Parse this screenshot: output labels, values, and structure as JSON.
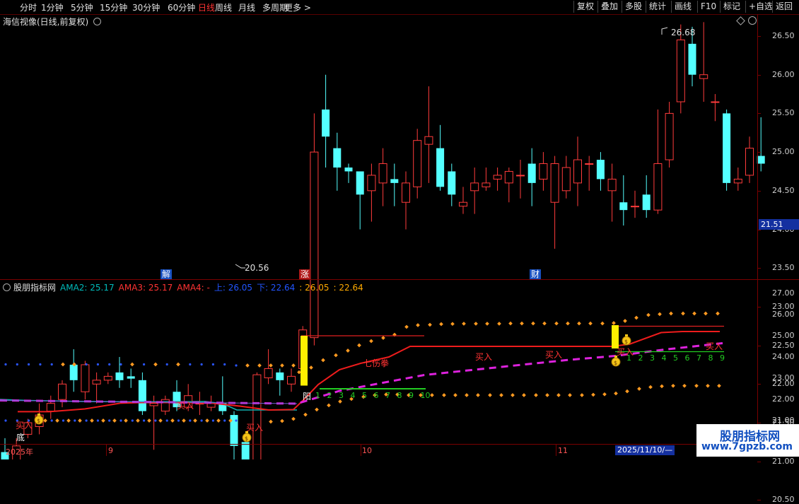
{
  "toolbar": {
    "periods": [
      "分时",
      "1分钟",
      "5分钟",
      "15分钟",
      "30分钟",
      "60分钟",
      "日线",
      "周线",
      "月线",
      "多周期",
      "更多 >"
    ],
    "active_period": "日线",
    "right_buttons": [
      "复权",
      "叠加",
      "多股",
      "统计",
      "画线",
      "F10",
      "标记",
      "+自选",
      "返回"
    ]
  },
  "main_chart": {
    "title": "海信视像(日线,前复权)",
    "price_axis": [
      "26.50",
      "26.00",
      "25.50",
      "25.00",
      "24.50",
      "24.00",
      "23.50",
      "23.00",
      "22.50",
      "22.00",
      "21.50",
      "21.00",
      "20.50"
    ],
    "current_price": "21.51",
    "high_label": "26.68",
    "low_label": "20.56",
    "event_markers": [
      {
        "text": "解",
        "color": "#2b6cff"
      },
      {
        "text": "涨",
        "color": "#d02020"
      },
      {
        "text": "财",
        "color": "#2b6cff"
      }
    ],
    "colors": {
      "up": "#ff3b3b",
      "down": "#54ffff"
    },
    "candles": [
      [
        21.12,
        21.0,
        20.9,
        21.3
      ],
      [
        21.0,
        21.2,
        20.85,
        21.3
      ],
      [
        21.35,
        21.5,
        21.3,
        21.55
      ],
      [
        21.45,
        21.6,
        21.35,
        21.75
      ],
      [
        21.65,
        21.75,
        21.55,
        21.85
      ],
      [
        21.8,
        22.0,
        21.7,
        22.05
      ],
      [
        22.25,
        22.05,
        21.9,
        22.45
      ],
      [
        21.9,
        22.25,
        21.8,
        22.3
      ],
      [
        22.0,
        22.05,
        21.75,
        22.15
      ],
      [
        22.05,
        22.1,
        22.0,
        22.15
      ],
      [
        22.15,
        22.05,
        21.95,
        22.35
      ],
      [
        22.1,
        22.07,
        21.95,
        22.2
      ],
      [
        22.05,
        21.65,
        21.6,
        22.15
      ],
      [
        21.72,
        21.75,
        21.15,
        21.85
      ],
      [
        21.65,
        21.8,
        21.6,
        21.85
      ],
      [
        21.9,
        21.7,
        21.65,
        22.05
      ],
      [
        21.7,
        21.85,
        21.65,
        22.0
      ],
      [
        21.75,
        21.75,
        21.6,
        21.9
      ],
      [
        21.7,
        21.75,
        21.65,
        21.85
      ],
      [
        21.75,
        21.65,
        21.6,
        22.1
      ],
      [
        21.6,
        21.2,
        20.9,
        21.65
      ],
      [
        21.25,
        20.8,
        20.56,
        21.3
      ],
      [
        20.82,
        22.12,
        20.75,
        22.15
      ],
      [
        22.08,
        22.2,
        22.0,
        22.45
      ],
      [
        22.15,
        22.05,
        21.85,
        22.2
      ],
      [
        22.0,
        22.1,
        21.9,
        22.2
      ],
      [
        22.2,
        22.7,
        22.1,
        22.75
      ],
      [
        22.6,
        25.0,
        22.5,
        25.5
      ],
      [
        25.55,
        25.2,
        24.8,
        26.0
      ],
      [
        25.05,
        24.8,
        24.5,
        25.25
      ],
      [
        24.8,
        24.75,
        24.6,
        24.85
      ],
      [
        24.75,
        24.45,
        24.0,
        24.7
      ],
      [
        24.5,
        24.7,
        24.1,
        24.85
      ],
      [
        24.6,
        24.85,
        24.3,
        25.05
      ],
      [
        24.65,
        24.6,
        24.3,
        24.85
      ],
      [
        24.35,
        24.6,
        24.0,
        24.75
      ],
      [
        24.55,
        25.15,
        24.4,
        25.3
      ],
      [
        25.1,
        25.2,
        24.6,
        25.85
      ],
      [
        25.05,
        24.55,
        24.5,
        25.35
      ],
      [
        24.75,
        24.45,
        24.3,
        24.85
      ],
      [
        24.3,
        24.35,
        24.2,
        24.55
      ],
      [
        24.5,
        24.6,
        24.2,
        24.8
      ],
      [
        24.55,
        24.6,
        24.5,
        24.8
      ],
      [
        24.65,
        24.7,
        24.5,
        24.8
      ],
      [
        24.6,
        24.75,
        24.35,
        24.8
      ],
      [
        24.7,
        24.7,
        24.4,
        24.9
      ],
      [
        24.85,
        24.6,
        24.3,
        25.05
      ],
      [
        24.65,
        24.85,
        24.5,
        25.0
      ],
      [
        24.35,
        24.85,
        23.75,
        24.95
      ],
      [
        24.5,
        24.8,
        24.4,
        24.95
      ],
      [
        24.6,
        24.9,
        24.3,
        25.2
      ],
      [
        24.85,
        24.85,
        24.5,
        24.95
      ],
      [
        24.9,
        24.65,
        24.5,
        25.0
      ],
      [
        24.5,
        24.65,
        24.1,
        24.85
      ],
      [
        24.35,
        24.25,
        24.05,
        24.7
      ],
      [
        24.3,
        24.3,
        24.15,
        24.5
      ],
      [
        24.45,
        24.25,
        24.15,
        24.7
      ],
      [
        24.25,
        24.85,
        24.2,
        25.55
      ],
      [
        24.9,
        25.5,
        24.8,
        25.65
      ],
      [
        25.65,
        26.45,
        25.5,
        26.65
      ],
      [
        26.4,
        26.0,
        25.85,
        26.62
      ],
      [
        25.95,
        26.0,
        25.65,
        26.68
      ],
      [
        25.65,
        25.65,
        25.4,
        25.75
      ],
      [
        25.5,
        24.6,
        24.5,
        25.55
      ],
      [
        24.6,
        24.65,
        24.5,
        24.8
      ],
      [
        24.7,
        25.05,
        24.6,
        25.2
      ],
      [
        24.95,
        24.85,
        24.75,
        25.45
      ]
    ]
  },
  "indicator": {
    "name": "股朋指标网",
    "values": [
      {
        "label": "AMA2: 25.17",
        "color": "#00bbbb"
      },
      {
        "label": "AMA3: 25.17",
        "color": "#ff3333"
      },
      {
        "label": "AMA4: -",
        "color": "#ff3333"
      },
      {
        "label": "上: 26.05",
        "color": "#2255ff"
      },
      {
        "label": "下: 22.64",
        "color": "#2255ff"
      },
      {
        "label": ": 26.05",
        "color": "#ffaa00"
      },
      {
        "label": ": 22.64",
        "color": "#ffaa00"
      }
    ],
    "axis": [
      "27.00",
      "26.00",
      "25.00",
      "24.00",
      "23.00",
      "22.00",
      "21.00"
    ],
    "labels": {
      "buy": "买入",
      "bottom": "底",
      "kill": "七伤拳",
      "sun": "阳"
    },
    "count_seq1": [
      "1",
      "2",
      "3",
      "4",
      "5",
      "6",
      "7",
      "8",
      "9",
      "10"
    ],
    "count_seq2": [
      "1",
      "2",
      "3",
      "4",
      "5",
      "6",
      "7",
      "8",
      "9"
    ]
  },
  "date_axis": {
    "labels": [
      "2025年",
      "9",
      "10",
      "11"
    ],
    "selected": "2025/11/10/—"
  },
  "watermark": {
    "line1": "股朋指标网",
    "line2": "www.7gpzb.com"
  }
}
